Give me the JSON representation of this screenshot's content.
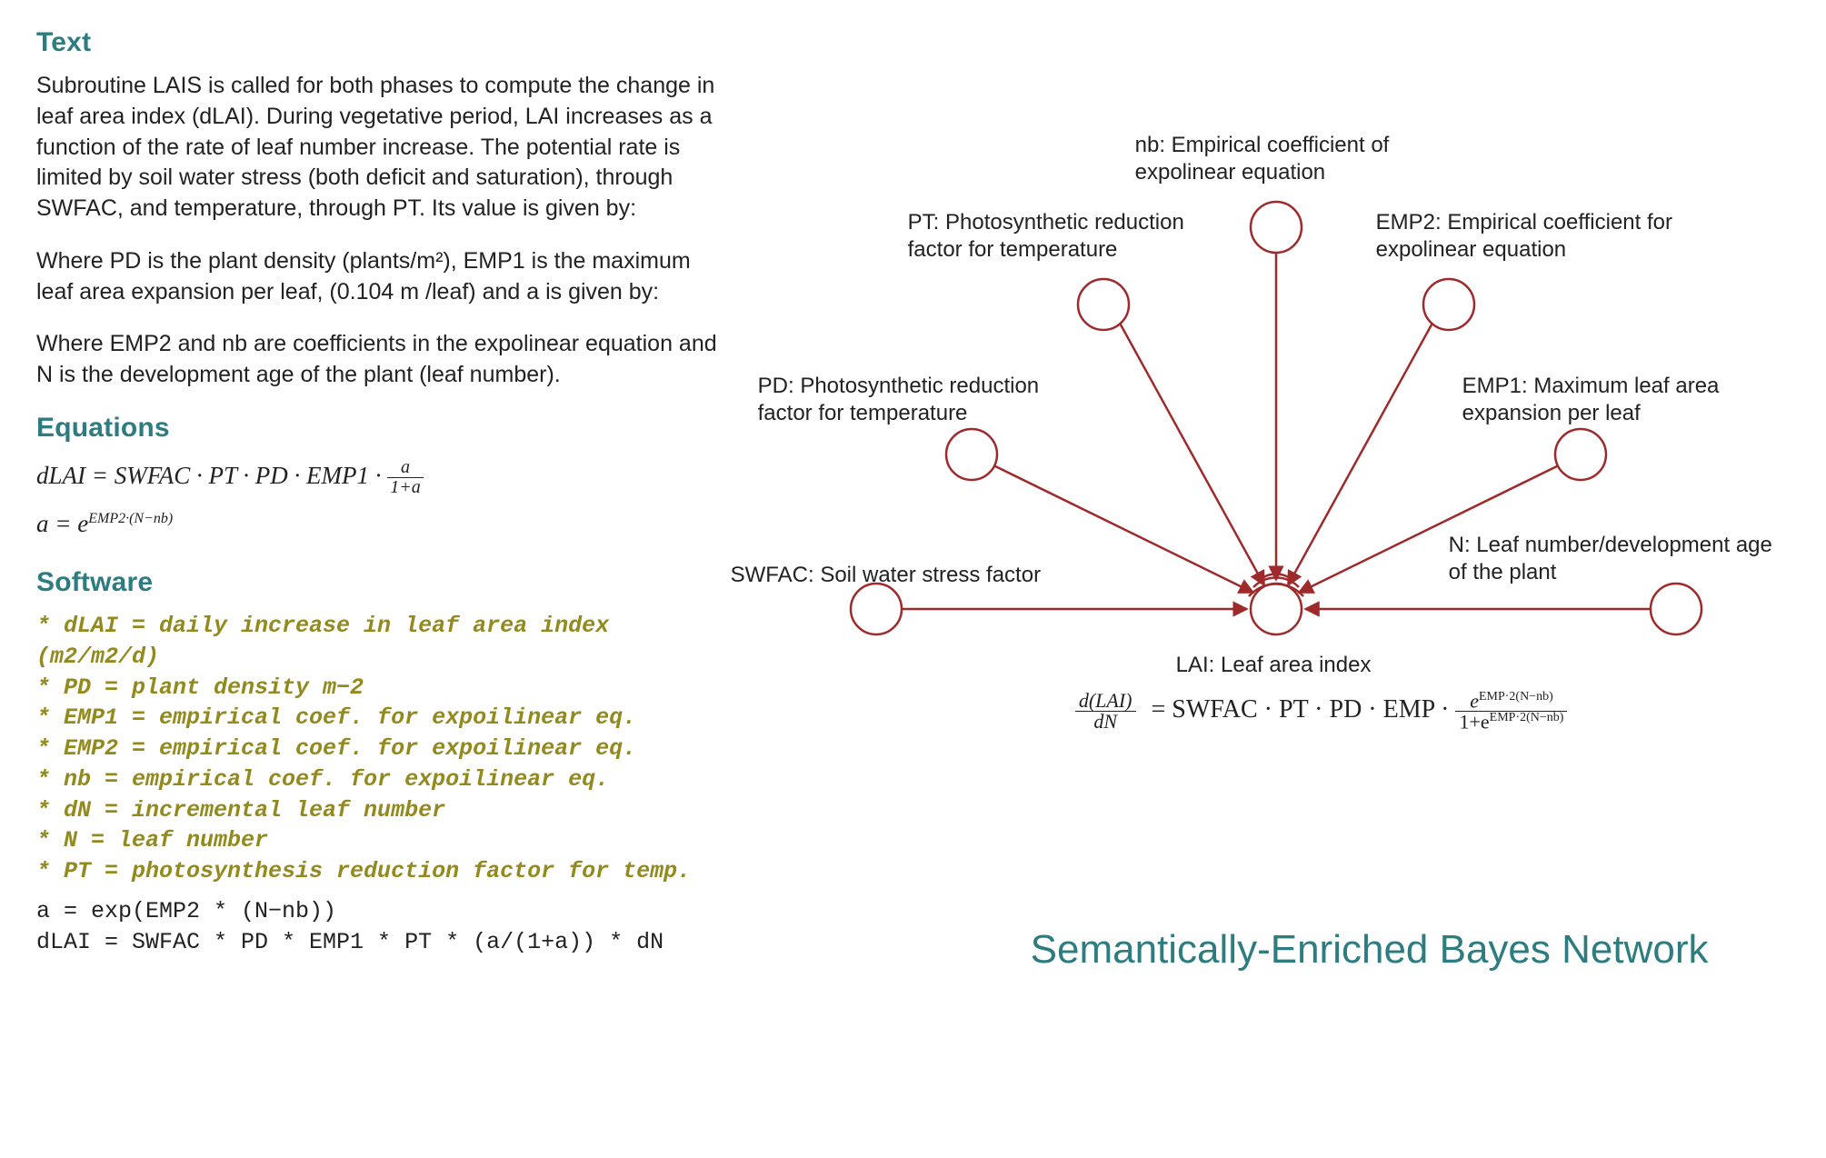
{
  "sections": {
    "text_heading": "Text",
    "text_p1": "Subroutine LAIS is called for both phases to compute the change in leaf area index (dLAI). During vegetative period, LAI increases as a function of the rate of leaf number increase.  The potential rate is limited by soil water stress (both deficit and saturation), through SWFAC, and temperature, through PT. Its value is given by:",
    "text_p2": "Where PD is the plant density (plants/m²), EMP1 is the maximum leaf area expansion per leaf, (0.104 m /leaf) and a is given by:",
    "text_p3": "Where EMP2 and nb are coefficients in the expolinear equation and N is the development age of the plant (leaf number).",
    "equations_heading": "Equations",
    "eq1_lhs": "dLAI = SWFAC · PT · PD · EMP1 · ",
    "eq1_frac_num": "a",
    "eq1_frac_den": "1+a",
    "eq2_lhs": "a = e",
    "eq2_exp": "EMP2·(N−nb)",
    "software_heading": "Software",
    "software_comments": "* dLAI = daily increase in leaf area index (m2/m2/d)\n* PD = plant density m−2\n* EMP1 = empirical coef. for expoilinear eq.\n* EMP2 = empirical coef. for expoilinear eq.\n* nb = empirical coef. for expoilinear eq.\n* dN = incremental leaf number\n* N = leaf number\n* PT = photosynthesis reduction factor for temp.",
    "software_code": "a = exp(EMP2 * (N−nb))\ndLAI = SWFAC * PD * EMP1 * PT * (a/(1+a)) * dN"
  },
  "diagram": {
    "title": "Semantically-Enriched Bayes Network",
    "center_label": "LAI: Leaf area index",
    "nodes": {
      "nb": "nb:  Empirical coefficient of expolinear equation",
      "pt": "PT: Photosynthetic reduction factor for temperature",
      "emp2": "EMP2:  Empirical coefficient for expolinear equation",
      "pd": "PD: Photosynthetic reduction factor for temperature",
      "emp1": "EMP1:  Maximum leaf area expansion per leaf",
      "swfac": "SWFAC: Soil water stress factor",
      "n": "N: Leaf number/development age of the plant"
    },
    "equation": {
      "lhs_num": "d(LAI)",
      "lhs_den": "dN",
      "mid": "=  SWFAC · PT · PD · EMP · ",
      "rhs_num_base": "e",
      "rhs_exp": "EMP·2(N−nb)",
      "rhs_den_prefix": "1+e"
    }
  },
  "chart_data": {
    "type": "diagram",
    "structure": "bayes-network",
    "center_node": {
      "id": "LAI",
      "label": "LAI: Leaf area index"
    },
    "input_nodes": [
      {
        "id": "SWFAC",
        "label": "SWFAC: Soil water stress factor"
      },
      {
        "id": "PD",
        "label": "PD: Photosynthetic reduction factor for temperature"
      },
      {
        "id": "PT",
        "label": "PT: Photosynthetic reduction factor for temperature"
      },
      {
        "id": "nb",
        "label": "nb: Empirical coefficient of expolinear equation"
      },
      {
        "id": "EMP2",
        "label": "EMP2: Empirical coefficient for expolinear equation"
      },
      {
        "id": "EMP1",
        "label": "EMP1: Maximum leaf area expansion per leaf"
      },
      {
        "id": "N",
        "label": "N: Leaf number/development age of the plant"
      }
    ],
    "edges": [
      {
        "from": "SWFAC",
        "to": "LAI"
      },
      {
        "from": "PD",
        "to": "LAI"
      },
      {
        "from": "PT",
        "to": "LAI"
      },
      {
        "from": "nb",
        "to": "LAI"
      },
      {
        "from": "EMP2",
        "to": "LAI"
      },
      {
        "from": "EMP1",
        "to": "LAI"
      },
      {
        "from": "N",
        "to": "LAI"
      }
    ],
    "output_equation": "d(LAI)/dN = SWFAC · PT · PD · EMP · e^{EMP·2(N−nb)} / (1 + e^{EMP·2(N−nb)})"
  }
}
